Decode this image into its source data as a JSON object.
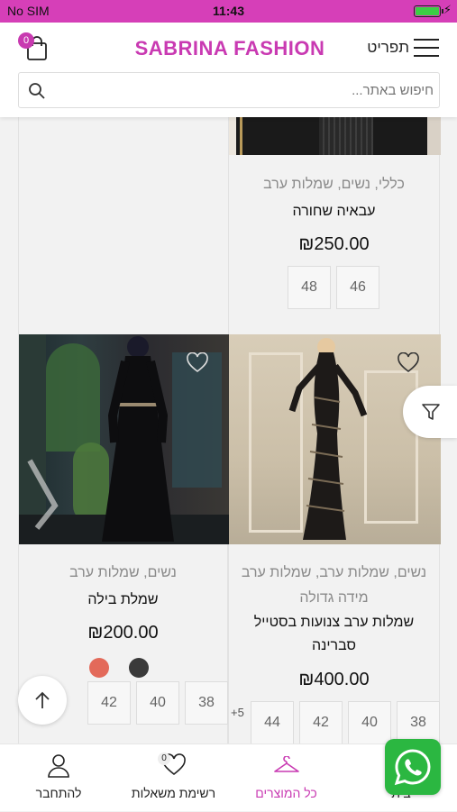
{
  "status_bar": {
    "carrier": "No SIM",
    "time": "11:43"
  },
  "header": {
    "brand": "SABRINA FASHION",
    "menu_label": "תפריט",
    "cart_count": "0",
    "search_placeholder": "חיפוש באתר..."
  },
  "products": [
    {
      "categories": "כללי, נשים, שמלות ערב",
      "name": "עבאיה שחורה",
      "price": "₪250.00",
      "sizes": [
        "46",
        "48"
      ]
    },
    {
      "categories": "נשים, שמלות ערב, שמלות ערב",
      "extra_category": "מידה גדולה",
      "name_line1": "שמלות ערב צנועות בסטייל",
      "name_line2": "סברינה",
      "price": "₪400.00",
      "sizes": [
        "38",
        "40",
        "42",
        "44"
      ],
      "more_sizes": "+5"
    },
    {
      "categories": "נשים, שמלות ערב",
      "name": "שמלת בילה",
      "price": "₪200.00",
      "sizes": [
        "38",
        "40",
        "42"
      ],
      "swatch_colors": [
        "#e36a5a",
        "#3a3a3a"
      ]
    }
  ],
  "tabbar": {
    "account": "להתחבר",
    "wishlist": "רשימת משאלות",
    "wishlist_count": "0",
    "all_products": "כל המוצרים",
    "home": "בית"
  },
  "colors": {
    "accent": "#c93ab2",
    "status_bar": "#d63fb8",
    "whatsapp": "#2bb741"
  }
}
